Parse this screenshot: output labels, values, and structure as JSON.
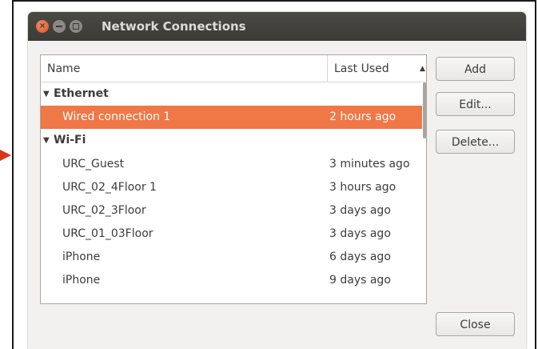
{
  "window": {
    "title": "Network Connections"
  },
  "list": {
    "columns": {
      "name": "Name",
      "last_used": "Last Used",
      "sort_indicator": "▲"
    },
    "groups": [
      {
        "name": "Ethernet",
        "expander": "▼",
        "connections": [
          {
            "name": "Wired connection 1",
            "last_used": "2 hours ago",
            "selected": true
          }
        ]
      },
      {
        "name": "Wi-Fi",
        "expander": "▼",
        "connections": [
          {
            "name": "URC_Guest",
            "last_used": "3 minutes ago"
          },
          {
            "name": "URC_02_4Floor 1",
            "last_used": "3 hours ago"
          },
          {
            "name": "URC_02_3Floor",
            "last_used": "3 days ago"
          },
          {
            "name": "URC_01_03Floor",
            "last_used": "3 days ago"
          },
          {
            "name": "iPhone",
            "last_used": "6 days ago"
          },
          {
            "name": "iPhone",
            "last_used": "9 days ago"
          }
        ]
      }
    ]
  },
  "buttons": {
    "add": "Add",
    "edit": "Edit...",
    "delete": "Delete...",
    "close": "Close"
  },
  "window_controls": {
    "close_glyph": "×"
  },
  "colors": {
    "selection": "#f07746",
    "titlebar": "#3c3b37",
    "pointer_arrow": "#d43a1a"
  }
}
